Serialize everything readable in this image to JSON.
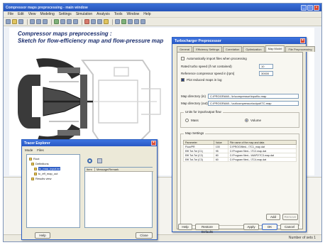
{
  "window": {
    "title": "Compressor maps preprocessing - main window"
  },
  "menu": [
    "File",
    "Edit",
    "View",
    "Modeling",
    "Settings",
    "Simulation",
    "Analysis",
    "Tools",
    "Window",
    "Help"
  ],
  "document": {
    "title_line1": "Compressor maps preprocessing :",
    "title_line2": "Sketch for flow-efficiency map and flow-pressure map"
  },
  "main_dialog": {
    "title": "Turbocharger Preprocessor",
    "tabs": [
      "General",
      "Efficiency Settings",
      "Correlation",
      "Optimization",
      "Map Model",
      "File Preprocessing"
    ],
    "active_tab_index": 4,
    "options": {
      "cb1": "Automatically import files when processing",
      "spin1_label": "Rated turbo speed (if not contained)",
      "spin1_value": "10",
      "spin2_label": "Reference compressor speed in [rpm]",
      "spin2_value": "30000",
      "cb2": "Plot reduced maps in log"
    },
    "paths": {
      "p1_label": "Map directory (in)",
      "p1_value": "C:\\PROGRAM\\...\\in\\compressor\\input\\tc.map",
      "p2_label": "Map directory (out)",
      "p2_value": "C:\\PROGRAM\\...\\out\\compressor\\output\\TC.map"
    },
    "groups": {
      "units": "Units for input/output flow",
      "map_settings": "Map Settings"
    },
    "radios": {
      "r1": "Mass",
      "r2": "Volume"
    },
    "table": {
      "headers": [
        "Parameter",
        "Value",
        "File name of the map and data"
      ],
      "rows": [
        [
          "Flow/PR",
          "100",
          "C:\\PROG\\files\\...\\TC1_map.dat"
        ],
        [
          "Effi.Tot-Tot (C1)",
          "95",
          "C:\\Program files\\...\\TC2.map.dat"
        ],
        [
          "Effi.Tot-Tot (C2)",
          "80",
          "C:\\Program files\\...\\MAP2\\TC3.map.dat"
        ],
        [
          "Effi.Tot-Tot (C3)",
          "60",
          "C:\\Program files\\...\\TC4.map.dat"
        ]
      ]
    },
    "inner_buttons": {
      "add": "Add",
      "remove": "Remove"
    },
    "footer_buttons": {
      "help": "Help",
      "restore": "Restore Defaults",
      "apply": "Apply",
      "ok": "OK",
      "cancel": "Cancel"
    }
  },
  "small_dialog": {
    "title": "Tracer Explorer",
    "menu": [
      "Mode",
      "Files"
    ],
    "tree": [
      "Root",
      "Definitions",
      "tc_map_input.txt",
      "tc_eff_map_out",
      "Results view"
    ],
    "selected_index": 2,
    "list_headers": [
      "Item",
      "Message/Remark"
    ],
    "buttons": {
      "left": "Help",
      "right": "Close"
    }
  },
  "status": {
    "text": "Number of sets 1"
  },
  "colors": {
    "title_blue": "#1c2f6e",
    "dialog_title": "#2958c4",
    "dialog_face": "#ece9d8"
  }
}
